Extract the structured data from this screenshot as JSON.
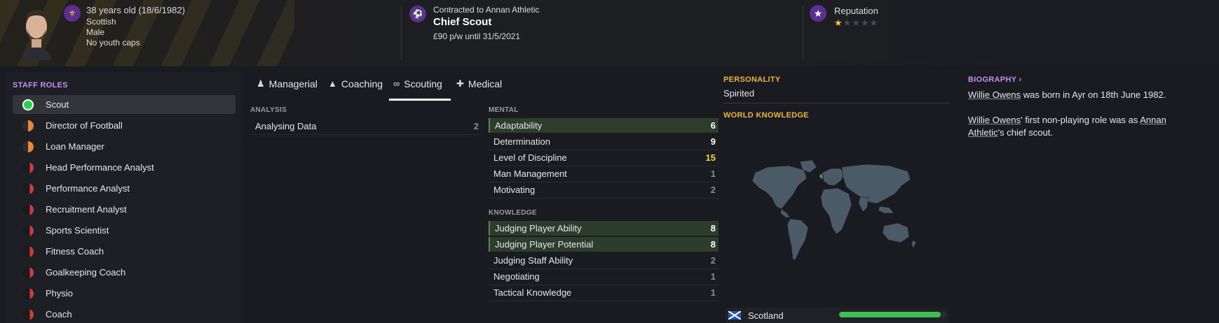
{
  "header": {
    "age_line": "38 years old (18/6/1982)",
    "nationality": "Scottish",
    "gender": "Male",
    "youth_caps": "No youth caps",
    "contract_line": "Contracted to Annan Athletic",
    "job_title": "Chief Scout",
    "wage_line": "£90 p/w until 31/5/2021",
    "reputation_label": "Reputation",
    "reputation_stars": 1,
    "reputation_max": 5
  },
  "staff_roles": {
    "title": "STAFF ROLES",
    "items": [
      {
        "label": "Scout",
        "suitability": "full",
        "color": "#2bd04a"
      },
      {
        "label": "Director of Football",
        "suitability": "half",
        "color": "#e8863a"
      },
      {
        "label": "Loan Manager",
        "suitability": "half",
        "color": "#e8863a"
      },
      {
        "label": "Head Performance Analyst",
        "suitability": "low",
        "color": "#d23a3a"
      },
      {
        "label": "Performance Analyst",
        "suitability": "low",
        "color": "#d23a3a"
      },
      {
        "label": "Recruitment Analyst",
        "suitability": "low",
        "color": "#d23a3a"
      },
      {
        "label": "Sports Scientist",
        "suitability": "low",
        "color": "#d23a3a"
      },
      {
        "label": "Fitness Coach",
        "suitability": "low",
        "color": "#d23a3a"
      },
      {
        "label": "Goalkeeping Coach",
        "suitability": "low",
        "color": "#d23a3a"
      },
      {
        "label": "Physio",
        "suitability": "low",
        "color": "#d23a3a"
      },
      {
        "label": "Coach",
        "suitability": "low",
        "color": "#d23a3a"
      }
    ]
  },
  "tabs": [
    {
      "label": "Managerial",
      "icon": "person-icon",
      "active": false
    },
    {
      "label": "Coaching",
      "icon": "cones-icon",
      "active": false
    },
    {
      "label": "Scouting",
      "icon": "binoculars-icon",
      "active": true
    },
    {
      "label": "Medical",
      "icon": "medkit-icon",
      "active": false
    }
  ],
  "analysis": {
    "title": "ANALYSIS",
    "items": [
      {
        "name": "Analysing Data",
        "value": "2"
      }
    ]
  },
  "mental": {
    "title": "MENTAL",
    "items": [
      {
        "name": "Adaptability",
        "value": "6",
        "highlight": true
      },
      {
        "name": "Determination",
        "value": "9",
        "highlight": false
      },
      {
        "name": "Level of Discipline",
        "value": "15",
        "highlight": false
      },
      {
        "name": "Man Management",
        "value": "1",
        "highlight": false
      },
      {
        "name": "Motivating",
        "value": "2",
        "highlight": false
      }
    ]
  },
  "knowledge": {
    "title": "KNOWLEDGE",
    "items": [
      {
        "name": "Judging Player Ability",
        "value": "8",
        "highlight": true
      },
      {
        "name": "Judging Player Potential",
        "value": "8",
        "highlight": true
      },
      {
        "name": "Judging Staff Ability",
        "value": "2",
        "highlight": false
      },
      {
        "name": "Negotiating",
        "value": "1",
        "highlight": false
      },
      {
        "name": "Tactical Knowledge",
        "value": "1",
        "highlight": false
      }
    ]
  },
  "personality": {
    "title": "PERSONALITY",
    "value": "Spirited"
  },
  "world_knowledge": {
    "title": "WORLD KNOWLEDGE",
    "nation": "Scotland",
    "knowledge_level": 0.95
  },
  "biography": {
    "title": "BIOGRAPHY",
    "p1_link": "Willie Owens",
    "p1_rest": " was born in Ayr on 18th June 1982.",
    "p2_link": "Willie Owens",
    "p2_mid": "' first non-playing role was as ",
    "p2_link2": "Annan Athletic",
    "p2_end": "'s chief scout."
  },
  "colors": {
    "accent_purple": "#c48ff0",
    "accent_gold": "#f0b43c",
    "highlight_green": "#2d3d2b",
    "bar_green": "#3fbf52"
  }
}
